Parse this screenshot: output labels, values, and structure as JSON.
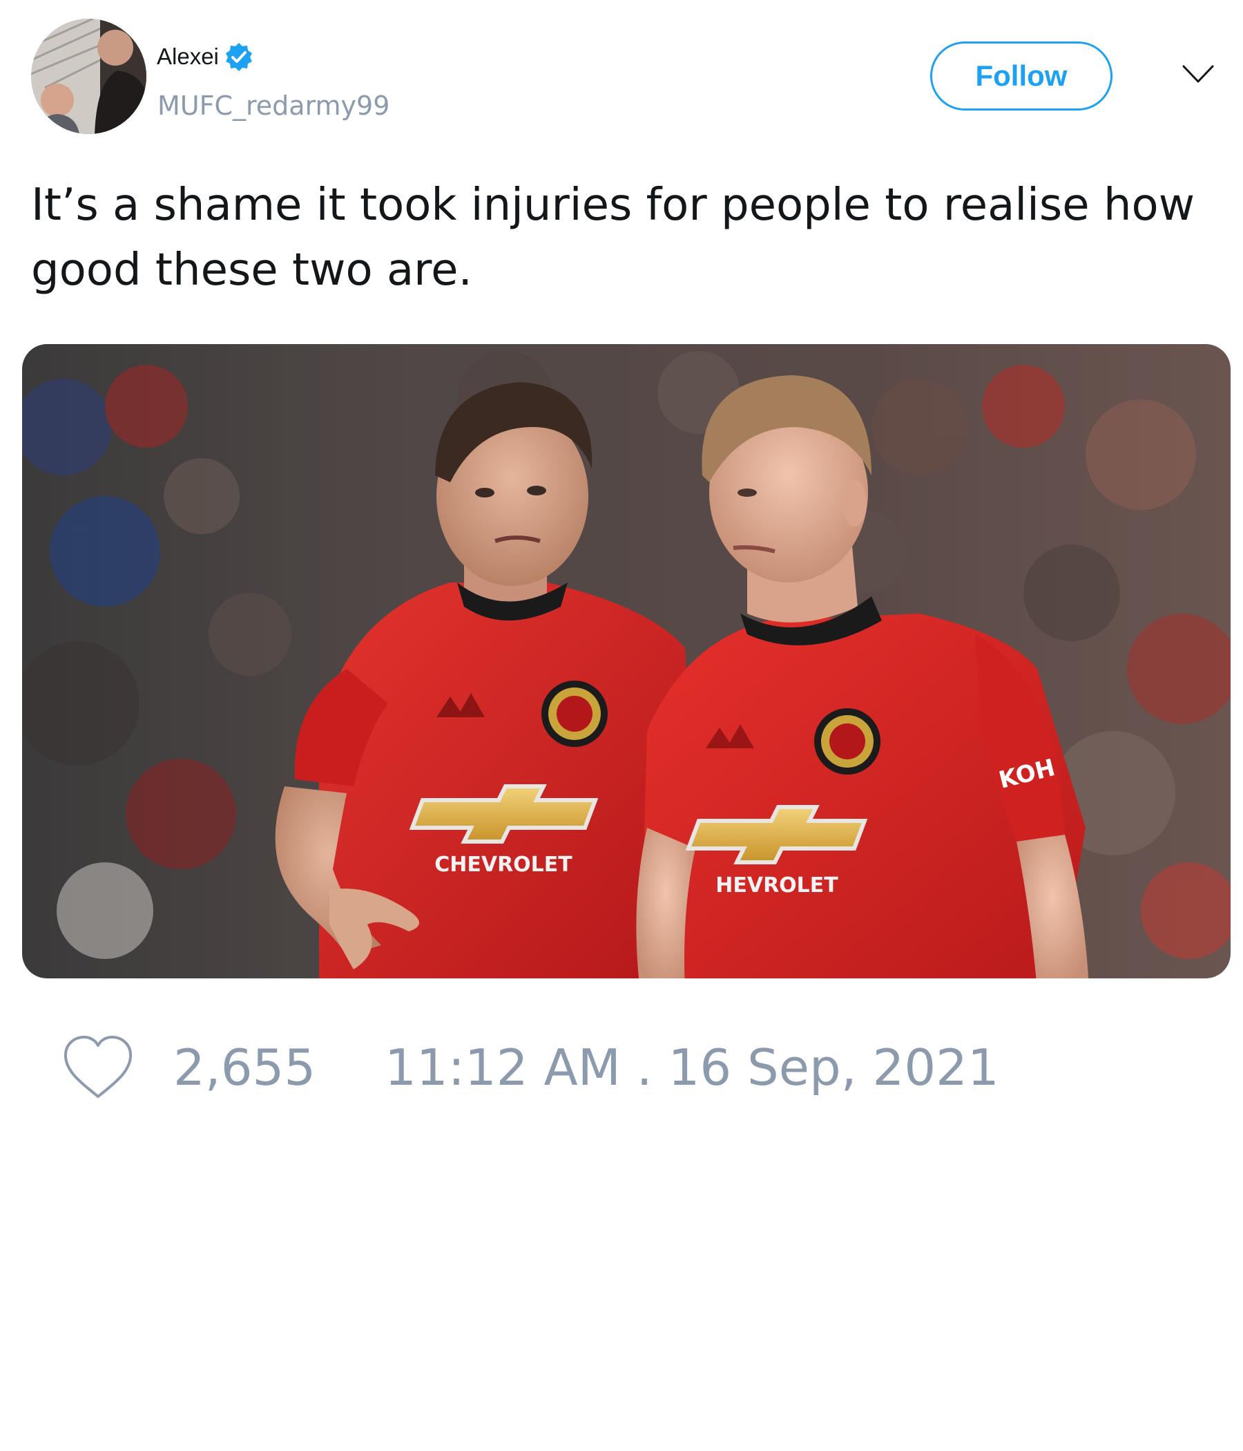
{
  "user": {
    "display_name": "Alexei",
    "handle": "MUFC_redarmy99",
    "verified_icon": "verified-badge-icon"
  },
  "actions": {
    "follow_label": "Follow",
    "more_icon": "chevron-down-icon"
  },
  "tweet": {
    "text": "It’s a shame it took injuries for people to realise how good these two are.",
    "image_text": {
      "sponsor_left": "CHEVROLET",
      "sponsor_right": "HEVROLET",
      "sleeve_sponsor": "KOH"
    }
  },
  "footer": {
    "like_icon": "heart-icon",
    "likes": "2,655",
    "timestamp": "11:12 AM . 16 Sep, 2021"
  },
  "colors": {
    "accent": "#1da1f2",
    "muted_text": "#8c9aad",
    "primary_text": "#14171a",
    "kit_red": "#d7211f"
  }
}
